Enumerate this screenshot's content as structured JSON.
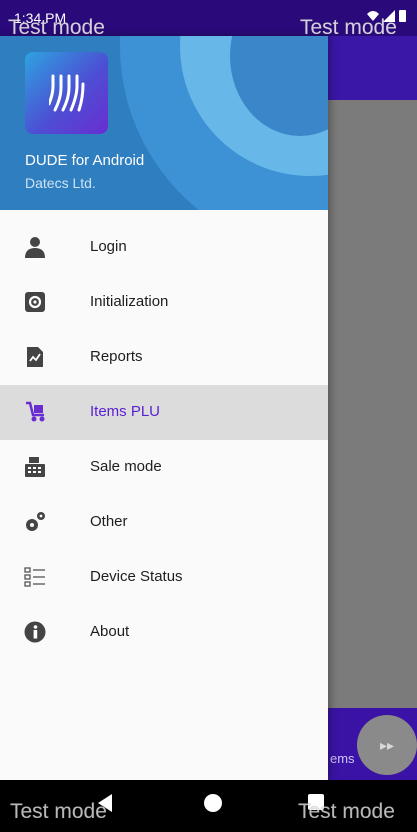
{
  "status_bar": {
    "time": "1:34 PM",
    "icons": "wifi-signal-battery"
  },
  "drawer": {
    "app_name": "DUDE for Android",
    "company": "Datecs Ltd.",
    "items": [
      {
        "label": "Login",
        "icon": "user-icon"
      },
      {
        "label": "Initialization",
        "icon": "gear-icon"
      },
      {
        "label": "Reports",
        "icon": "report-icon"
      },
      {
        "label": "Items PLU",
        "icon": "cart-icon",
        "active": true
      },
      {
        "label": "Sale mode",
        "icon": "cash-register-icon"
      },
      {
        "label": "Other",
        "icon": "gears-icon"
      },
      {
        "label": "Device Status",
        "icon": "checklist-icon"
      },
      {
        "label": "About",
        "icon": "info-icon"
      }
    ]
  },
  "overlay": {
    "test_mode": "Test mode"
  },
  "background": {
    "bottom_label": "ems",
    "fab_label": "▸▸"
  },
  "colors": {
    "accent": "#5a1fd1",
    "toolbar": "#3b17a8",
    "status_bar": "#2a0a7a",
    "header": "#2f7fc0"
  }
}
